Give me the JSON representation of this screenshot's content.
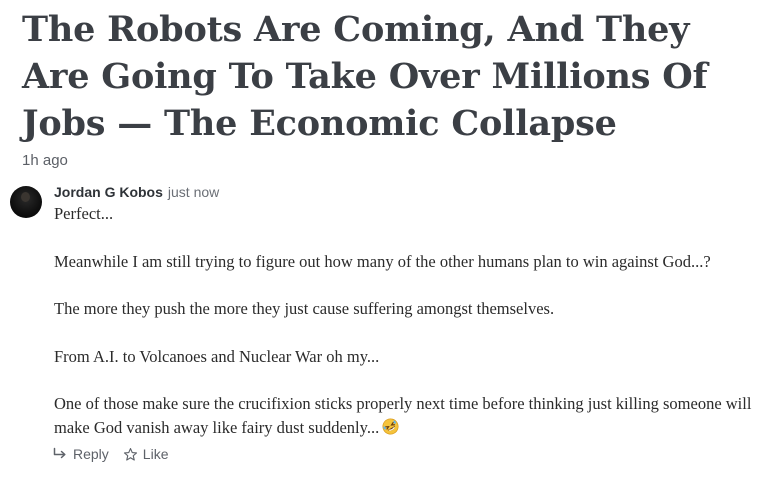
{
  "article": {
    "title": "The Robots Are Coming, And They Are Going To Take Over Millions Of Jobs — The Economic Collapse",
    "time_ago": "1h ago"
  },
  "comment": {
    "author": "Jordan G Kobos",
    "timestamp": "just now",
    "paragraphs": [
      "Perfect...",
      "Meanwhile I am still trying to figure out how many of the other humans plan to win against God...?",
      "The more they push the more they just cause suffering amongst themselves.",
      "From A.I. to Volcanoes and Nuclear War oh my...",
      "One of those make sure the crucifixion sticks properly next time before thinking just killing someone will make God vanish away like fairy dust suddenly..."
    ],
    "emoji_icon": "rolling-on-floor-laughing-icon",
    "actions": {
      "reply_label": "Reply",
      "like_label": "Like"
    }
  }
}
